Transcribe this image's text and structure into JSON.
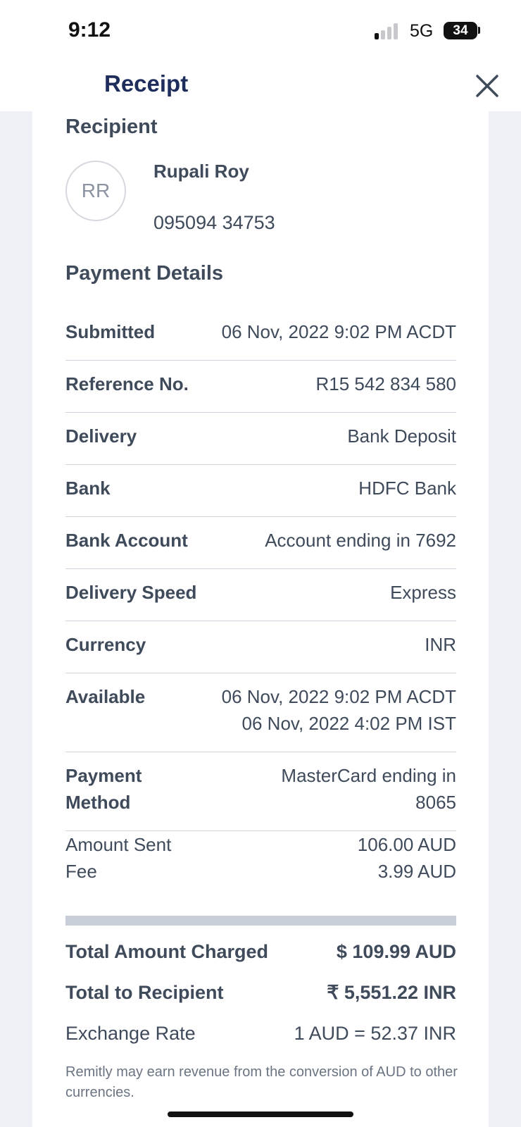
{
  "status_bar": {
    "time": "9:12",
    "network": "5G",
    "battery": "34"
  },
  "header": {
    "title": "Receipt"
  },
  "recipient": {
    "section_title": "Recipient",
    "initials": "RR",
    "name": "Rupali Roy",
    "phone": "095094 34753"
  },
  "payment_details": {
    "section_title": "Payment Details",
    "rows": [
      {
        "label": "Submitted",
        "value": "06 Nov, 2022 9:02 PM ACDT"
      },
      {
        "label": "Reference No.",
        "value": "R15 542 834 580"
      },
      {
        "label": "Delivery",
        "value": "Bank Deposit"
      },
      {
        "label": "Bank",
        "value": "HDFC Bank"
      },
      {
        "label": "Bank Account",
        "value": "Account ending in 7692"
      },
      {
        "label": "Delivery Speed",
        "value": "Express"
      },
      {
        "label": "Currency",
        "value": "INR"
      }
    ],
    "available": {
      "label": "Available",
      "value_line1": "06 Nov, 2022 9:02 PM ACDT",
      "value_line2": "06 Nov, 2022 4:02 PM IST"
    },
    "payment_method": {
      "label": "Payment Method",
      "value": "MasterCard ending in 8065"
    }
  },
  "amounts": {
    "sent_label": "Amount Sent",
    "sent_value": "106.00 AUD",
    "fee_label": "Fee",
    "fee_value": "3.99 AUD"
  },
  "totals": {
    "charged_label": "Total Amount Charged",
    "charged_value": "$ 109.99 AUD",
    "recipient_label": "Total to Recipient",
    "recipient_value": "₹ 5,551.22 INR",
    "rate_label": "Exchange Rate",
    "rate_value": "1 AUD = 52.37 INR"
  },
  "disclaimer": "Remitly may earn revenue from the conversion of AUD to other currencies.",
  "colors": {
    "title": "#1f2d5c",
    "text": "#3f4a5a",
    "background": "#eef0f5",
    "divider": "#c8ced8"
  }
}
